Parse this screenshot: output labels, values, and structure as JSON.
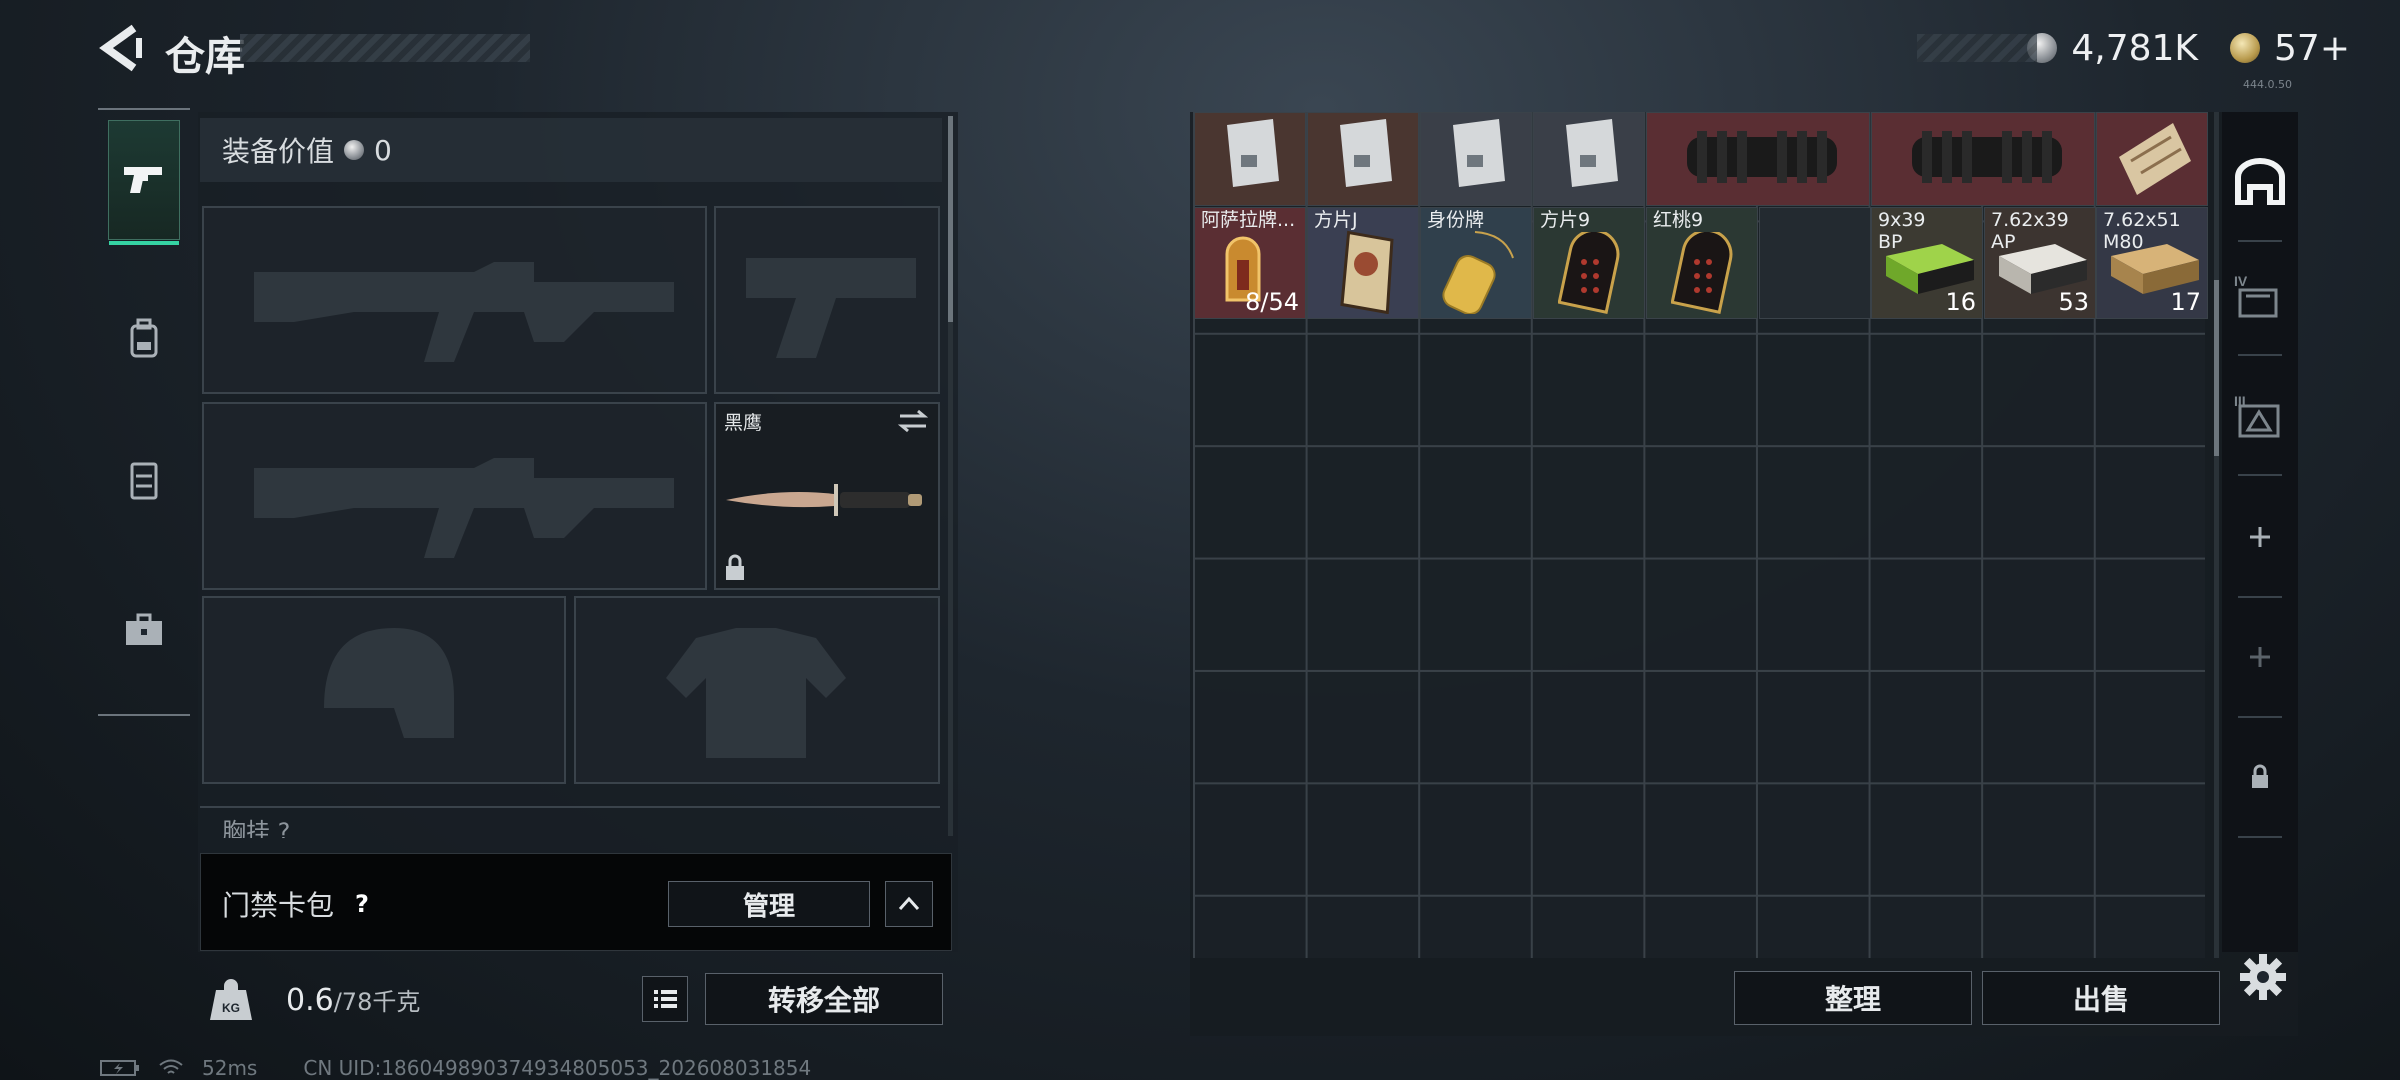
{
  "header": {
    "title": "仓库",
    "silver_currency": "4,781K",
    "gold_currency": "57+",
    "version_tag": "444.0.50"
  },
  "nav": {
    "items": [
      "weapons-icon",
      "backpack-icon",
      "vest-icon",
      "toolbox-icon"
    ]
  },
  "equipment": {
    "value_label": "装备价值",
    "value_amount": "0",
    "melee_name": "黑鹰",
    "chest_label": "胸挂 ?",
    "access_card_label": "门禁卡包",
    "access_help": "?",
    "manage_button": "管理",
    "weight_current": "0.6",
    "weight_capacity": "/78千克",
    "transfer_all_button": "转移全部"
  },
  "stash": {
    "row_top": [
      {
        "name": "",
        "color": "#4a3630"
      },
      {
        "name": "",
        "color": "#4a3630"
      },
      {
        "name": "",
        "color": "#3a3f48"
      },
      {
        "name": "",
        "color": "#3a3f48"
      },
      {
        "name": "",
        "color": "#5a2e33"
      },
      {
        "name": "",
        "color": "#5a2e33"
      },
      {
        "name": "",
        "color": "#5a2e33"
      }
    ],
    "row_items": [
      {
        "name": "阿萨拉牌...",
        "qty": "8/54",
        "color": "#5a2e33"
      },
      {
        "name": "方片J",
        "qty": "",
        "color": "#3a3f52"
      },
      {
        "name": "身份牌",
        "qty": "",
        "color": "#30404c"
      },
      {
        "name": "方片9",
        "qty": "",
        "color": "#2b3833"
      },
      {
        "name": "红桃9",
        "qty": "",
        "color": "#2b3833"
      },
      {
        "name": "",
        "qty": "",
        "color": "#232a30"
      },
      {
        "name": "9x39 BP",
        "qty": "16",
        "color": "#3c3a32"
      },
      {
        "name": "7.62x39 AP",
        "qty": "53",
        "color": "#3c3430"
      },
      {
        "name": "7.62x51 M80",
        "qty": "17",
        "color": "#343846"
      }
    ],
    "tidy_button": "整理",
    "sell_button": "出售"
  },
  "rail": {
    "items": [
      "stash-home-icon",
      "container-iv-icon",
      "container-iii-icon",
      "add-slot-icon",
      "add-slot-icon",
      "lock-icon"
    ]
  },
  "status": {
    "ping": "52ms",
    "uid": "CN UID:186049890374934805053_202608031854"
  }
}
